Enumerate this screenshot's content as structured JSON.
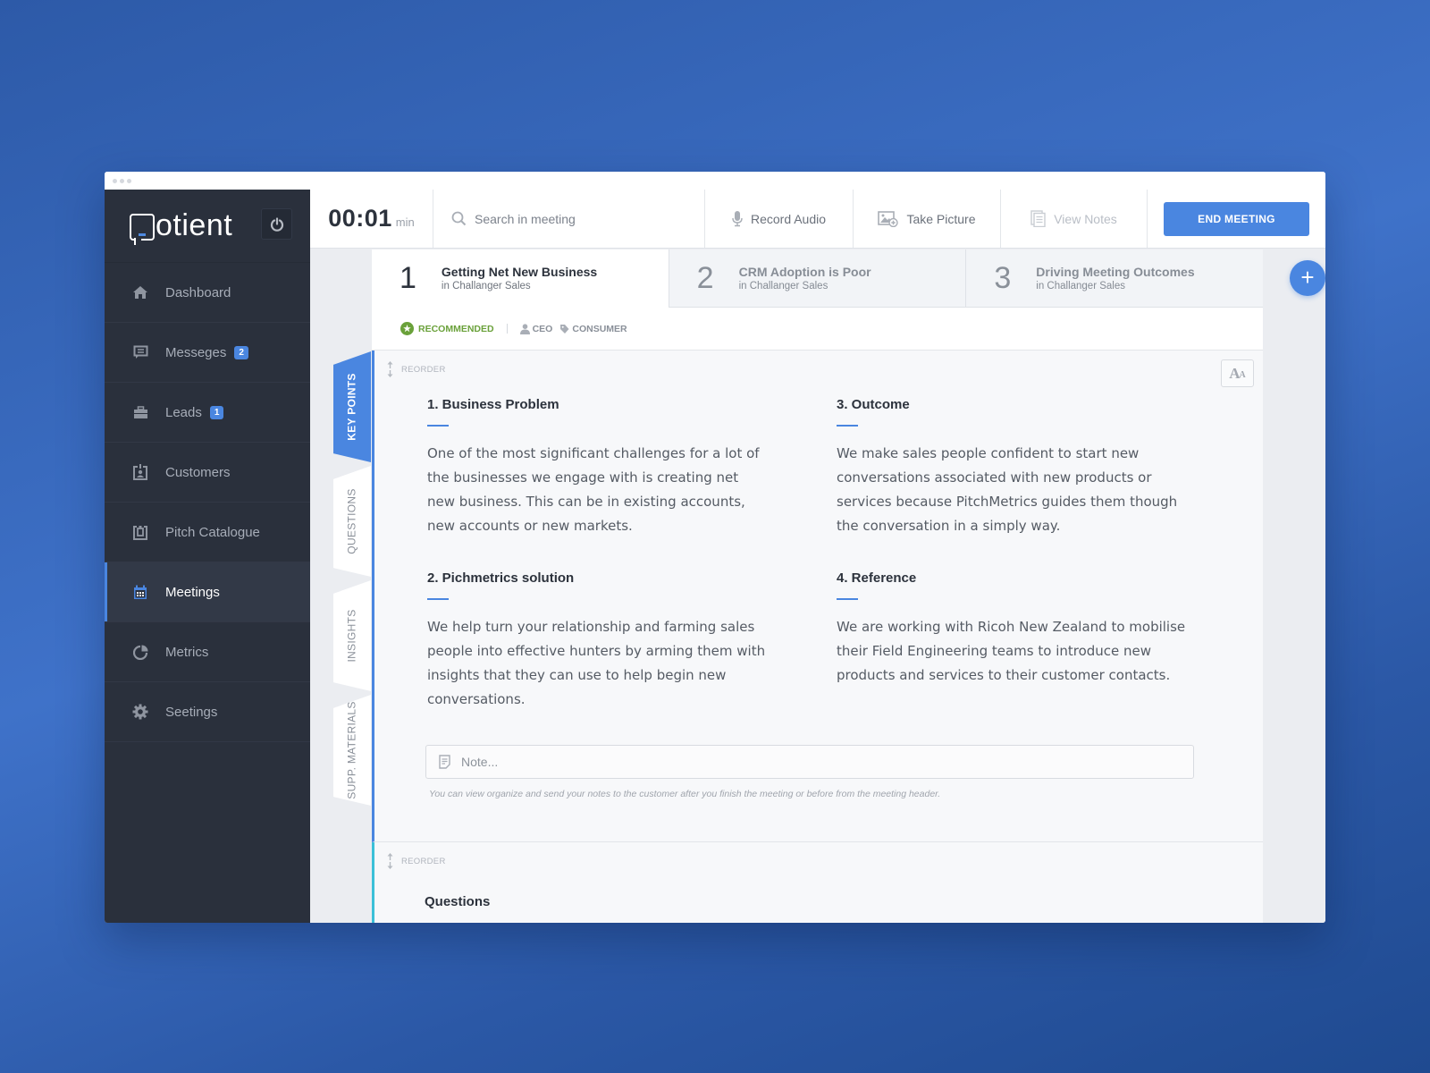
{
  "app": {
    "name": "otient"
  },
  "sidebar": {
    "items": [
      {
        "label": "Dashboard",
        "icon": "home-icon"
      },
      {
        "label": "Messeges",
        "icon": "message-icon",
        "badge": "2"
      },
      {
        "label": "Leads",
        "icon": "briefcase-icon",
        "badge": "1"
      },
      {
        "label": "Customers",
        "icon": "id-badge-icon"
      },
      {
        "label": "Pitch Catalogue",
        "icon": "clipboard-icon"
      },
      {
        "label": "Meetings",
        "icon": "calendar-icon",
        "active": true
      },
      {
        "label": "Metrics",
        "icon": "pie-chart-icon"
      },
      {
        "label": "Seetings",
        "icon": "gear-icon"
      }
    ]
  },
  "topbar": {
    "timer": "00:01",
    "timer_unit": "min",
    "search_placeholder": "Search in meeting",
    "record_audio": "Record Audio",
    "take_picture": "Take Picture",
    "view_notes": "View Notes",
    "end_meeting": "END MEETING"
  },
  "topics": [
    {
      "num": "1",
      "title": "Getting Net New Business",
      "sub": "in Challanger Sales",
      "active": true
    },
    {
      "num": "2",
      "title": "CRM Adoption is Poor",
      "sub": "in Challanger Sales"
    },
    {
      "num": "3",
      "title": "Driving Meeting Outcomes",
      "sub": "in Challanger Sales"
    }
  ],
  "add_topic": "+",
  "meta": {
    "recommended": "RECOMMENDED",
    "role": "CEO",
    "segment": "CONSUMER"
  },
  "side_tabs": [
    "KEY POINTS",
    "QUESTIONS",
    "INSIGHTS",
    "SUPP. MATERIALS"
  ],
  "colors": {
    "accent": "#4a86e0",
    "recommended": "#6aa13a",
    "questions_accent": "#3bc0d8",
    "sidebar_bg": "#2a303c"
  },
  "key_points": {
    "reorder": "REORDER",
    "font_button": "A",
    "font_button_small": "A",
    "items": [
      {
        "title": "1. Business Problem",
        "text": "One of the most significant challenges for a lot of the businesses we engage with is creating net new business. This can be in existing accounts, new accounts or new markets."
      },
      {
        "title": "3. Outcome",
        "text": "We make sales people confident to start new conversations associated with new products or services because PitchMetrics guides them though the conversation in a simply way."
      },
      {
        "title": "2. Pichmetrics solution",
        "text": "We help turn your relationship and farming sales people into effective hunters by arming them with insights that they can use to help begin new conversations."
      },
      {
        "title": "4. Reference",
        "text": "We are working with Ricoh New Zealand to mobilise their Field Engineering teams to introduce new products and services to their customer contacts."
      }
    ],
    "note_placeholder": "Note...",
    "helper": "You can view organize and send your notes to the customer after you finish the meeting or before from the meeting header."
  },
  "questions": {
    "reorder": "REORDER",
    "title": "Questions"
  }
}
